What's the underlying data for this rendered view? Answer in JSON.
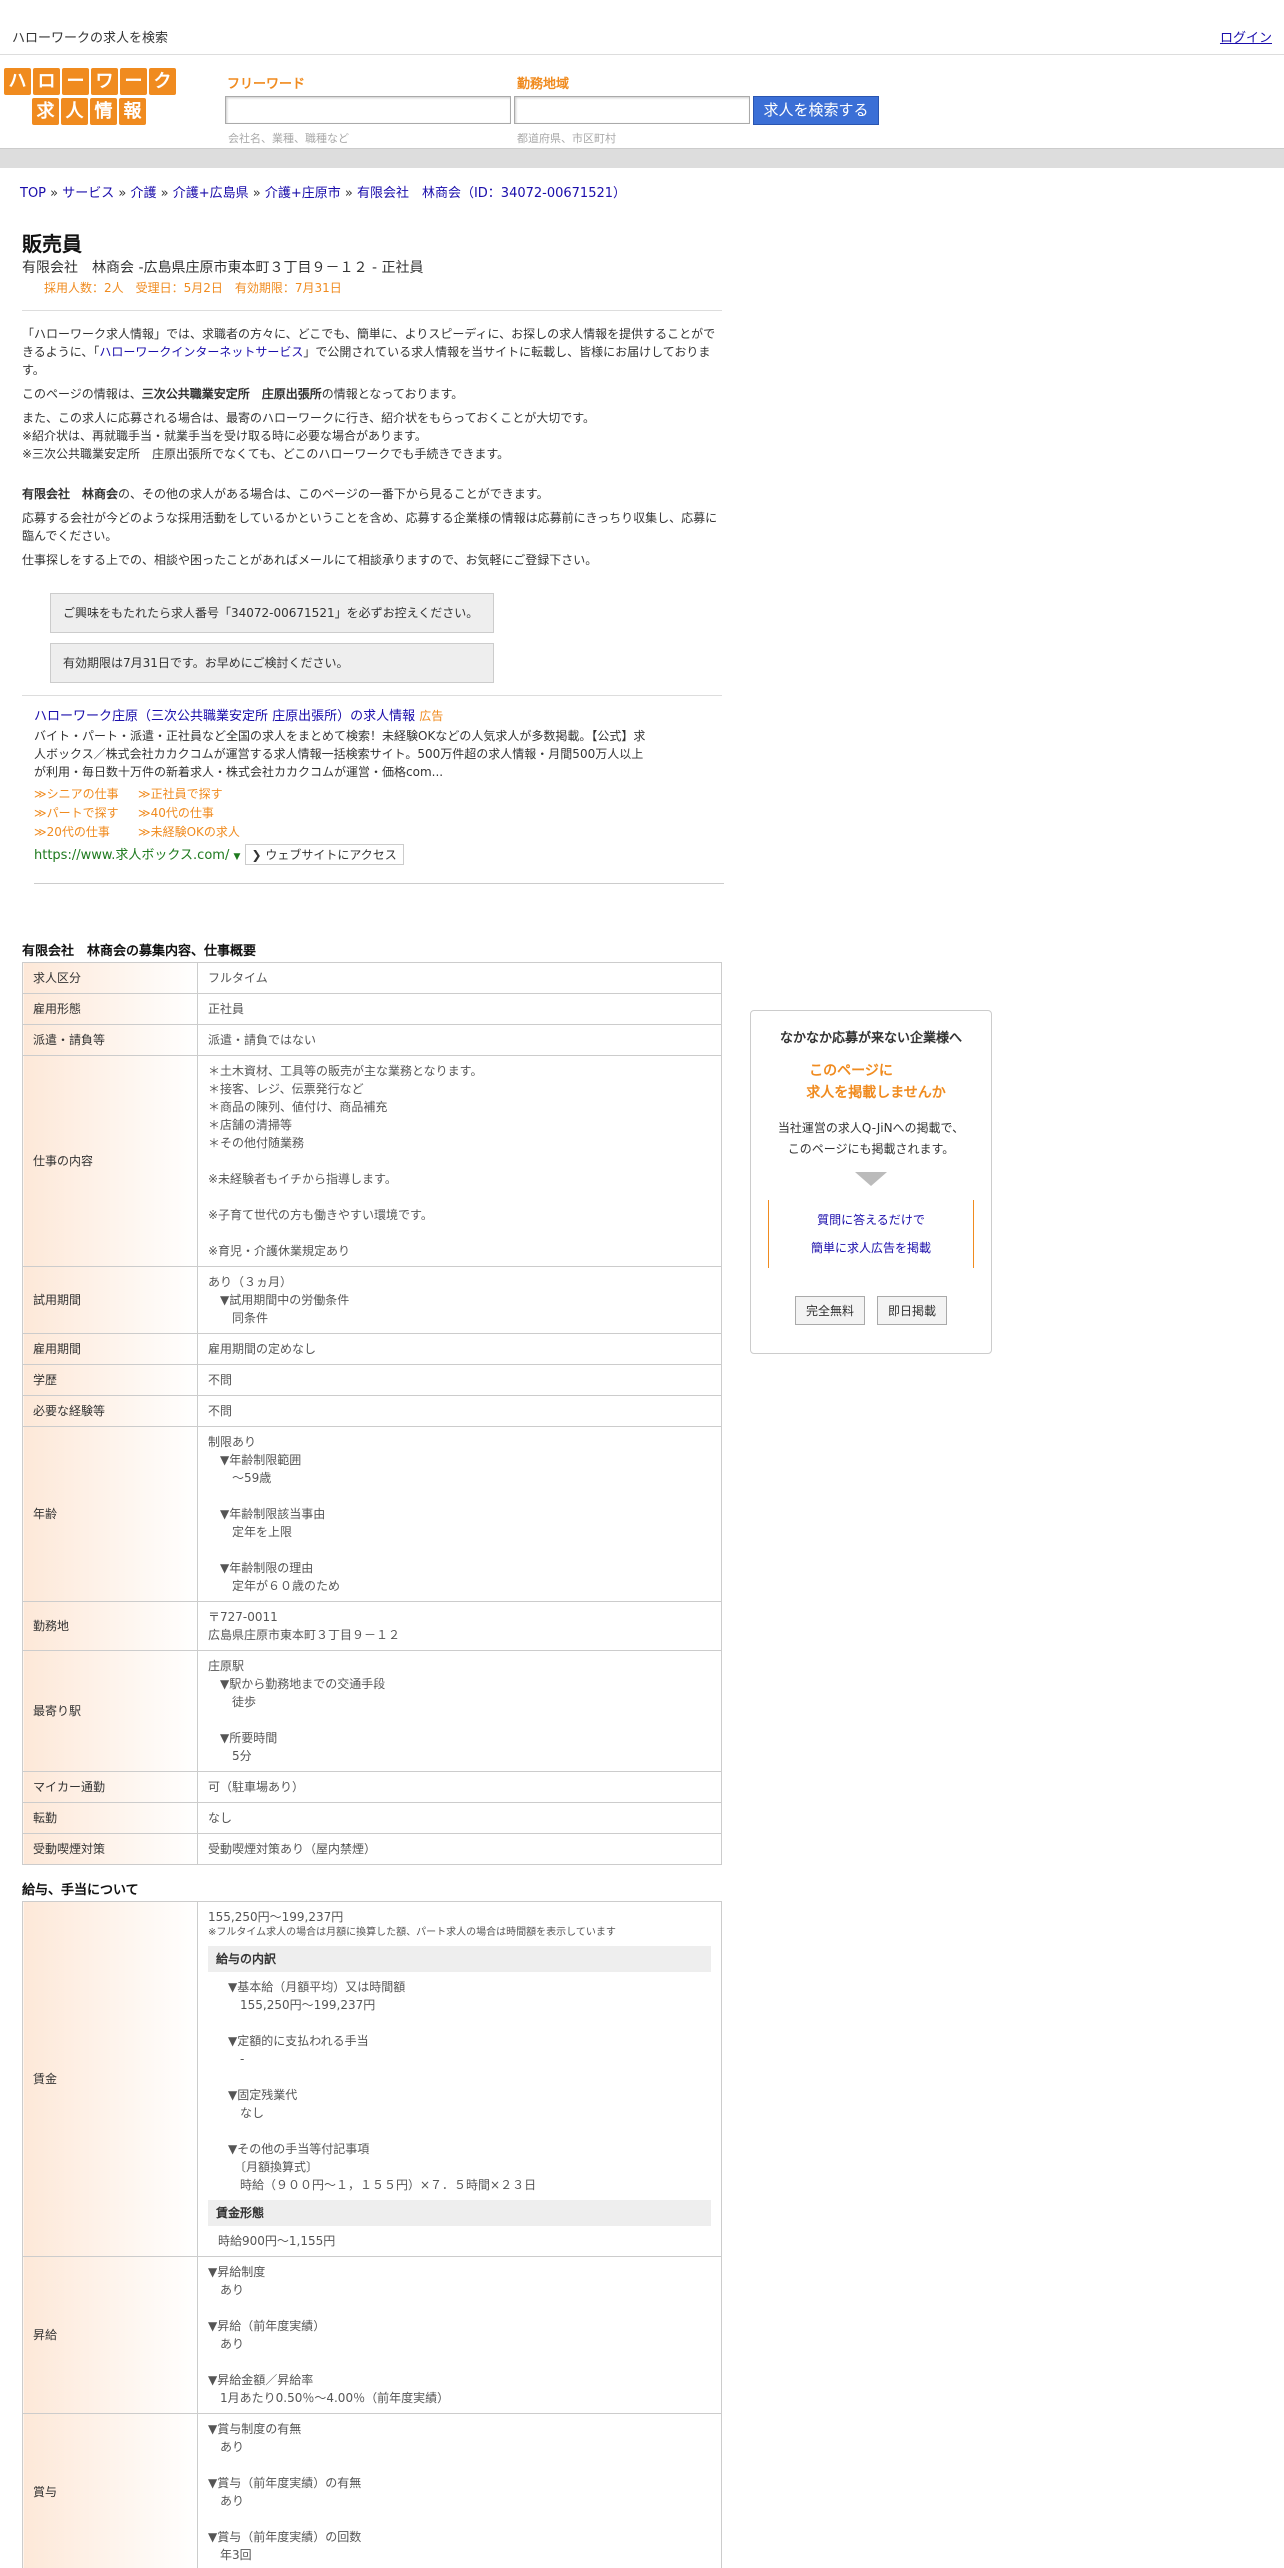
{
  "topbar": {
    "title": "ハローワークの求人を検索",
    "login": "ログイン"
  },
  "logo": {
    "line1": [
      "ハ",
      "ロ",
      "ー",
      "ワ",
      "ー",
      "ク"
    ],
    "line2": [
      "求",
      "人",
      "情",
      "報"
    ]
  },
  "search": {
    "keyword_label": "フリーワード",
    "keyword_placeholder": "会社名、業種、職種など",
    "area_label": "勤務地域",
    "area_placeholder": "都道府県、市区町村",
    "button": "求人を検索する"
  },
  "breadcrumb": [
    "TOP",
    "サービス",
    "介護",
    "介護+広島県",
    "介護+庄原市",
    "有限会社　林商会（ID：34072-00671521）"
  ],
  "job": {
    "title": "販売員",
    "subtitle": "有限会社　林商会 -広島県庄原市東本町３丁目９－１２ - 正社員",
    "meta": "採用人数：2人　受理日：5月2日　有効期限：7月31日"
  },
  "intro": {
    "p1a": "「ハローワーク求人情報」では、求職者の方々に、どこでも、簡単に、よりスピーディに、お探しの求人情報を提供することができるように、「",
    "p1link": "ハローワークインターネットサービス",
    "p1b": "」で公開されている求人情報を当サイトに転載し、皆様にお届けしております。",
    "p2a": "このページの情報は、",
    "p2b": "三次公共職業安定所　庄原出張所",
    "p2c": "の情報となっております。",
    "p3": [
      "また、この求人に応募される場合は、最寄のハローワークに行き、紹介状をもらっておくことが大切です。",
      "※紹介状は、再就職手当・就業手当を受け取る時に必要な場合があります。",
      "※三次公共職業安定所　庄原出張所でなくても、どこのハローワークでも手続きできます。"
    ],
    "p4a": "有限会社　林商会",
    "p4b": "の、その他の求人がある場合は、このページの一番下から見ることができます。",
    "p5": "応募する会社が今どのような採用活動をしているかということを含め、応募する企業様の情報は応募前にきっちり収集し、応募に臨んでください。",
    "p6": "仕事探しをする上での、相談や困ったことがあればメールにて相談承りますので、お気軽にご登録下さい。"
  },
  "notice": {
    "box1": "ご興味をもたれたら求人番号「34072-00671521」を必ずお控えください。",
    "box2": "有効期限は7月31日です。お早めにご検討ください。"
  },
  "ad": {
    "title": "ハローワーク庄原（三次公共職業安定所 庄原出張所）の求人情報",
    "badge": "広告",
    "desc": "バイト・パート・派遣・正社員など全国の求人をまとめて検索！未経験OKなどの人気求人が多数掲載。【公式】求人ボックス／株式会社カカクコムが運営する求人情報一括検索サイト。500万件超の求人情報・月間500万人以上が利用・毎日数十万件の新着求人・株式会社カカクコムが運営・価格com...",
    "links": [
      [
        "≫シニアの仕事",
        "≫正社員で探す"
      ],
      [
        "≫パートで探す",
        "≫40代の仕事"
      ],
      [
        "≫20代の仕事",
        "≫未経験OKの求人"
      ]
    ],
    "url": "https://www.求人ボックス.com/",
    "visit": "ウェブサイトにアクセス"
  },
  "overview": {
    "heading": "有限会社　林商会の募集内容、仕事概要",
    "rows": [
      {
        "label": "求人区分",
        "value": [
          "フルタイム"
        ]
      },
      {
        "label": "雇用形態",
        "value": [
          "正社員"
        ]
      },
      {
        "label": "派遣・請負等",
        "value": [
          "派遣・請負ではない"
        ]
      },
      {
        "label": "仕事の内容",
        "value": [
          "＊土木資材、工具等の販売が主な業務となります。",
          "＊接客、レジ、伝票発行など",
          "＊商品の陳列、値付け、商品補充",
          "＊店舗の清掃等",
          "＊その他付随業務",
          "",
          "※未経験者もイチから指導します。",
          "",
          "※子育て世代の方も働きやすい環境です。",
          "",
          "※育児・介護休業規定あり"
        ]
      },
      {
        "label": "試用期間",
        "value": [
          "あり（３ヵ月）",
          "　▼試用期間中の労働条件",
          "　　同条件"
        ]
      },
      {
        "label": "雇用期間",
        "value": [
          "雇用期間の定めなし"
        ]
      },
      {
        "label": "学歴",
        "value": [
          "不問"
        ]
      },
      {
        "label": "必要な経験等",
        "value": [
          "不問"
        ]
      },
      {
        "label": "年齢",
        "value": [
          "制限あり",
          "　▼年齢制限範囲",
          "　　〜59歳",
          "",
          "　▼年齢制限該当事由",
          "　　定年を上限",
          "",
          "　▼年齢制限の理由",
          "　　定年が６０歳のため"
        ]
      },
      {
        "label": "勤務地",
        "value": [
          "〒727-0011",
          "広島県庄原市東本町３丁目９－１２"
        ]
      },
      {
        "label": "最寄り駅",
        "value": [
          "庄原駅",
          "　▼駅から勤務地までの交通手段",
          "　　徒歩",
          "",
          "　▼所要時間",
          "　　5分"
        ]
      },
      {
        "label": "マイカー通勤",
        "value": [
          "可（駐車場あり）"
        ]
      },
      {
        "label": "転勤",
        "value": [
          "なし"
        ]
      },
      {
        "label": "受動喫煙対策",
        "value": [
          "受動喫煙対策あり（屋内禁煙）"
        ]
      }
    ]
  },
  "salary": {
    "heading": "給与、手当について",
    "wage_label": "賃金",
    "wage_range": "155,250円〜199,237円",
    "wage_note": "※フルタイム求人の場合は月額に換算した額、パート求人の場合は時間額を表示しています",
    "breakdown_title": "給与の内訳",
    "breakdown": [
      "▼基本給（月額平均）又は時間額",
      "　155,250円〜199,237円",
      "",
      "▼定額的に支払われる手当",
      "　-",
      "",
      "▼固定残業代",
      "　なし",
      "",
      "▼その他の手当等付記事項",
      "　〔月額換算式〕",
      "　時給（９００円〜１，１５５円）×７．５時間×２３日"
    ],
    "form_title": "賃金形態",
    "form_value": "時給900円〜1,155円",
    "raise_label": "昇給",
    "raise": [
      "▼昇給制度",
      "　あり",
      "",
      "▼昇給（前年度実績）",
      "　あり",
      "",
      "▼昇給金額／昇給率",
      "　1月あたり0.50％〜4.00％（前年度実績）"
    ],
    "bonus_label": "賞与",
    "bonus": [
      "▼賞与制度の有無",
      "　あり",
      "",
      "▼賞与（前年度実績）の有無",
      "　あり",
      "",
      "▼賞与（前年度実績）の回数",
      "　年3回"
    ]
  },
  "side": {
    "title": "なかなか応募が来ない企業様へ",
    "catch1": "このページに",
    "catch2": "求人を掲載しませんか",
    "desc1": "当社運営の求人Q-JiNへの掲載で、",
    "desc2": "このページにも掲載されます。",
    "link1": "質問に答えるだけで",
    "link2": "簡単に求人広告を掲載",
    "btn1": "完全無料",
    "btn2": "即日掲載"
  }
}
